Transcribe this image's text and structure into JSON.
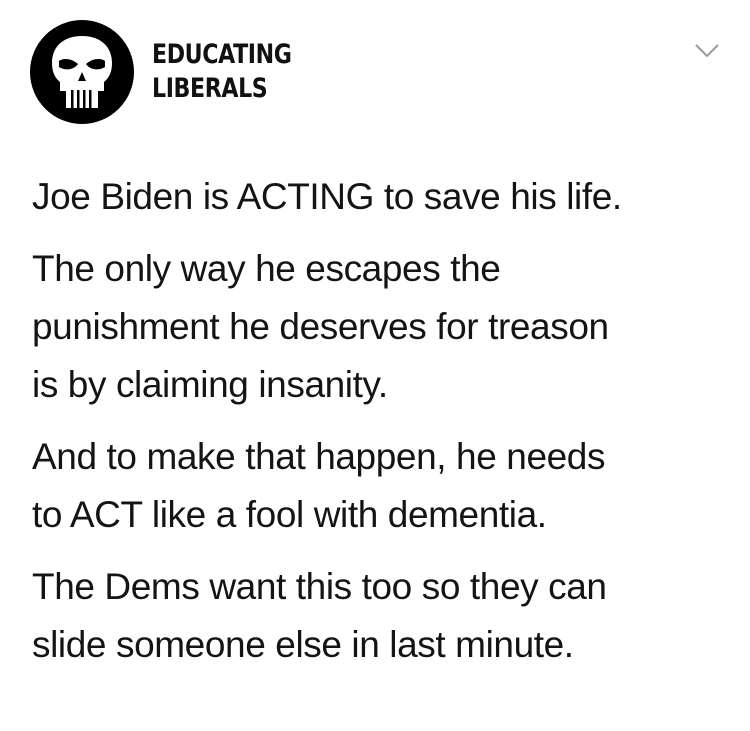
{
  "account": {
    "name_line1": "EDUCATING",
    "name_line2": "LIBERALS",
    "avatar_icon": "skull-icon",
    "avatar_bg": "#000000"
  },
  "header": {
    "menu_icon": "chevron-down-icon"
  },
  "post": {
    "paragraphs": [
      {
        "lines": [
          "Joe Biden is ACTING to save his life."
        ]
      },
      {
        "lines": [
          "The only way he escapes the",
          "punishment he deserves for treason",
          "is by claiming insanity."
        ]
      },
      {
        "lines": [
          "And to make that happen, he needs",
          "to ACT like a fool with dementia."
        ]
      },
      {
        "lines": [
          "The Dems want this too so they can",
          "slide someone else in last minute."
        ]
      }
    ]
  }
}
